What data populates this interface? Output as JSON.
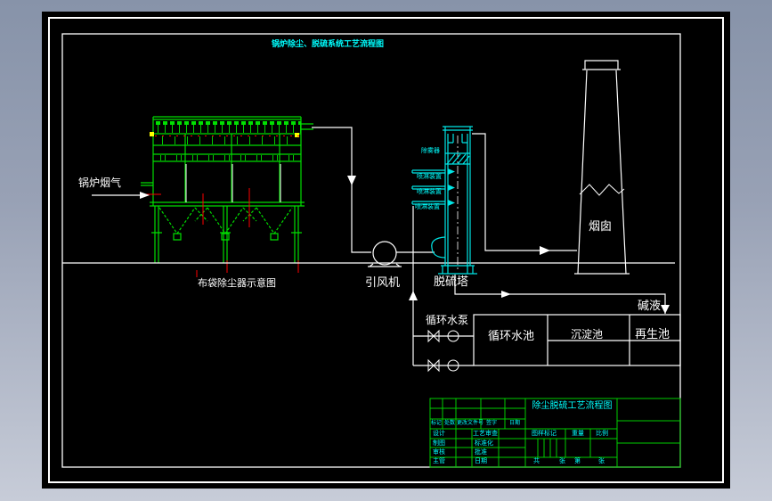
{
  "drawing": {
    "main_title": "锅炉除尘、脱硫系统工艺流程图",
    "labels": {
      "boiler_flue_gas": "锅炉烟气",
      "baghouse": "布袋除尘器示意图",
      "fan": "引风机",
      "tower": "脱硫塔",
      "chimney": "烟囱",
      "pump": "循环水泵",
      "alkali": "碱液"
    },
    "tower_internals": {
      "demister": "除雾器",
      "spray_levels": [
        "喷淋装置",
        "喷淋装置",
        "喷淋装置"
      ]
    },
    "pools": [
      "循环水池",
      "沉淀池",
      "再生池"
    ],
    "title_block": {
      "drawing_name": "除尘脱硫工艺流程图",
      "revision_header": [
        "标记",
        "处数",
        "更改文件号",
        "签字",
        "日期"
      ],
      "left_rows": [
        "设计",
        "制图",
        "审核",
        "主管"
      ],
      "mid_rows": [
        "工艺审查",
        "标准化",
        "批准",
        "日期"
      ],
      "stamp_header": [
        "图样标记",
        "重量",
        "比例"
      ],
      "sheet_info": [
        "共",
        "张",
        "第",
        "张"
      ]
    },
    "colors": {
      "canvas": "#000000",
      "line_green": "#00ff00",
      "line_cyan": "#00ffff",
      "line_white": "#ffffff",
      "line_red": "#ff0000",
      "line_yellow": "#ffff00"
    }
  }
}
